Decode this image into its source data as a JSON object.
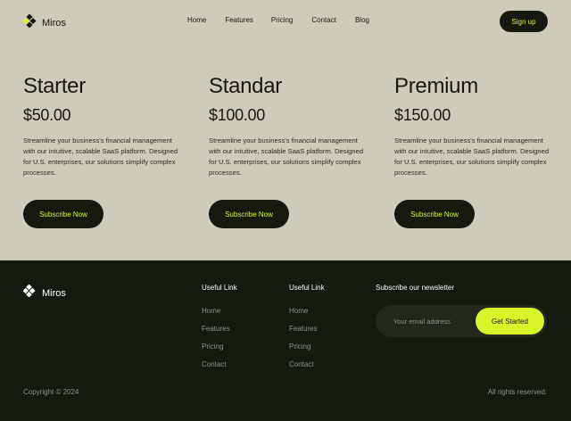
{
  "header": {
    "brand": "Miros",
    "nav": [
      "Home",
      "Features",
      "Pricing",
      "Contact",
      "Blog"
    ],
    "signup_label": "Sign up"
  },
  "plans": [
    {
      "name": "Starter",
      "price": "$50.00",
      "description": "Streamline your business's financial management with our intuitive, scalable SaaS platform. Designed for U.S. enterprises, our solutions simplify complex processes.",
      "button": "Subscribe Now"
    },
    {
      "name": "Standar",
      "price": "$100.00",
      "description": "Streamline your business's financial management with our intuitive, scalable SaaS platform. Designed for U.S. enterprises, our solutions simplify complex processes.",
      "button": "Subscribe Now"
    },
    {
      "name": "Premium",
      "price": "$150.00",
      "description": "Streamline your business's financial management with our intuitive, scalable SaaS platform. Designed for U.S. enterprises, our solutions simplify complex processes.",
      "button": "Subscribe Now"
    }
  ],
  "footer": {
    "brand": "Miros",
    "columns": [
      {
        "title": "Useful Link",
        "links": [
          "Home",
          "Features",
          "Pricing",
          "Contact"
        ]
      },
      {
        "title": "Useful Link",
        "links": [
          "Home",
          "Features",
          "Pricing",
          "Contact"
        ]
      }
    ],
    "newsletter": {
      "title": "Subscribe our newsletter",
      "placeholder": "Your email address",
      "button": "Get Started"
    },
    "copyright": "Copyright © 2024",
    "rights": "All rights reserved."
  },
  "colors": {
    "background": "#cfcbbb",
    "dark": "#141a0f",
    "accent": "#d8f52a"
  },
  "icons": {
    "logo": "diamond-cluster-icon"
  }
}
